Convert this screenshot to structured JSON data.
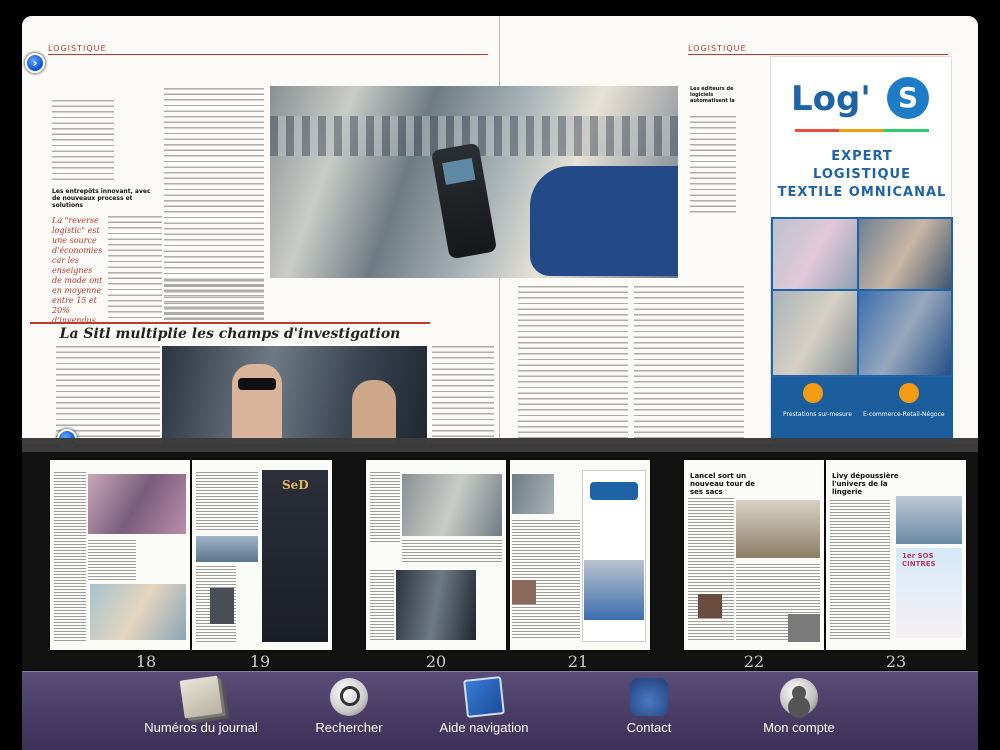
{
  "spread": {
    "rubric_left": "LOGISTIQUE",
    "rubric_right": "LOGISTIQUE",
    "section_head": "Les entrepôts innovant, avec de nouveaux process et solutions",
    "pull_quote": "La \"reverse logistic\" est une source d'économies car les enseignes de mode ont en moyenne entre 15 et 20% d'invendus.",
    "article_title": "La Sitl multiplie les champs d'investigation",
    "sidebar_head": "Les éditeurs de logiciels automatisent la gestion des retours."
  },
  "ad": {
    "brand": "Log'",
    "brand_s": "S",
    "tag1": "EXPERT",
    "tag2": "LOGISTIQUE",
    "tag3": "TEXTILE OMNICANAL",
    "bottom_left": "Prestations sur-mesure",
    "bottom_right": "E-commerce-Retail-Négoce"
  },
  "thumbnails": [
    {
      "label": "18"
    },
    {
      "label": "19"
    },
    {
      "label": "20"
    },
    {
      "label": "21"
    },
    {
      "label": "22"
    },
    {
      "label": "23"
    }
  ],
  "thumb_texts": {
    "p19_brand": "SeD",
    "p22_title": "Lancel sort un nouveau tour de ses sacs",
    "p23_title": "Livy dépoussière l'univers de la lingerie",
    "p23_ad": "1er SOS CINTRES"
  },
  "toolbar": {
    "journals": "Numéros du journal",
    "search": "Rechercher",
    "help": "Aide navigation",
    "contact": "Contact",
    "account": "Mon compte"
  },
  "colors": {
    "accent_red": "#c0392b",
    "brand_blue": "#1e63a6",
    "toolbar_purple": "#4a3e66",
    "nav_button": "#0b4fcf"
  }
}
